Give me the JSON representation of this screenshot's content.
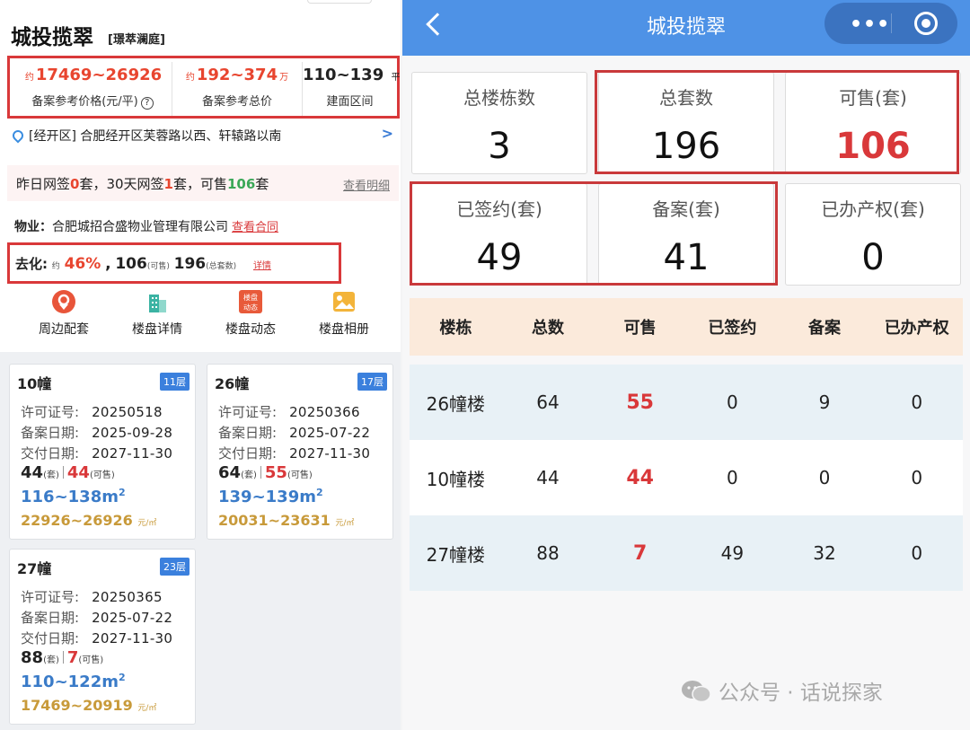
{
  "left": {
    "title": "城投揽翠",
    "alias": "[璟萃澜庭]",
    "price": {
      "unit_price_prefix": "约",
      "unit_price": "17469~26926",
      "unit_price_label": "备案参考价格(元/平)",
      "total_prefix": "约",
      "total_price": "192~374",
      "total_unit": "万",
      "total_label": "备案参考总价",
      "area": "110~139",
      "area_unit": "平",
      "area_label": "建面区间"
    },
    "address": "[经开区] 合肥经开区芙蓉路以西、轩辕路以南",
    "sign": {
      "t1": "昨日网签",
      "v1": "0",
      "t2": "套，30天网签",
      "v2": "1",
      "t3": "套，可售",
      "v3": "106",
      "t4": "套",
      "detail": "查看明细"
    },
    "property": {
      "label": "物业：",
      "company": "合肥城招合盛物业管理有限公司",
      "contract": "查看合同"
    },
    "destock": {
      "label": "去化:",
      "approx": "约",
      "rate": "46%",
      "sep": ",",
      "available": "106",
      "available_tag": "(可售)",
      "total": "196",
      "total_tag": "(总套数)",
      "link": "详情"
    },
    "nav": [
      {
        "label": "周边配套"
      },
      {
        "label": "楼盘详情"
      },
      {
        "label": "楼盘动态",
        "icon_text1": "楼盘",
        "icon_text2": "动态"
      },
      {
        "label": "楼盘相册"
      }
    ],
    "cards": [
      {
        "name": "10幢",
        "floors": "11层",
        "permit_k": "许可证号:",
        "permit": "20250518",
        "record_k": "备案日期:",
        "record": "2025-09-28",
        "deliver_k": "交付日期:",
        "deliver": "2027-11-30",
        "total": "44",
        "total_unit": "(套)",
        "avail": "44",
        "avail_tag": "(可售)",
        "area": "116~138m",
        "area_sup": "2",
        "price": "22926~26926",
        "price_unit": "元/㎡"
      },
      {
        "name": "26幢",
        "floors": "17层",
        "permit_k": "许可证号:",
        "permit": "20250366",
        "record_k": "备案日期:",
        "record": "2025-07-22",
        "deliver_k": "交付日期:",
        "deliver": "2027-11-30",
        "total": "64",
        "total_unit": "(套)",
        "avail": "55",
        "avail_tag": "(可售)",
        "area": "139~139m",
        "area_sup": "2",
        "price": "20031~23631",
        "price_unit": "元/㎡"
      },
      {
        "name": "27幢",
        "floors": "23层",
        "permit_k": "许可证号:",
        "permit": "20250365",
        "record_k": "备案日期:",
        "record": "2025-07-22",
        "deliver_k": "交付日期:",
        "deliver": "2027-11-30",
        "total": "88",
        "total_unit": "(套)",
        "avail": "7",
        "avail_tag": "(可售)",
        "area": "110~122m",
        "area_sup": "2",
        "price": "17469~20919",
        "price_unit": "元/㎡"
      }
    ]
  },
  "right": {
    "title": "城投揽翠",
    "stats": [
      {
        "label": "总楼栋数",
        "value": "3"
      },
      {
        "label": "总套数",
        "value": "196"
      },
      {
        "label": "可售(套)",
        "value": "106"
      },
      {
        "label": "已签约(套)",
        "value": "49"
      },
      {
        "label": "备案(套)",
        "value": "41"
      },
      {
        "label": "已办产权(套)",
        "value": "0"
      }
    ],
    "table": {
      "headers": [
        "楼栋",
        "总数",
        "可售",
        "已签约",
        "备案",
        "已办产权"
      ],
      "rows": [
        [
          "26幢楼",
          "64",
          "55",
          "0",
          "9",
          "0"
        ],
        [
          "10幢楼",
          "44",
          "44",
          "0",
          "0",
          "0"
        ],
        [
          "27幢楼",
          "88",
          "7",
          "49",
          "32",
          "0"
        ]
      ]
    },
    "watermark": "公众号 · 话说探家"
  },
  "colors": {
    "accent_red": "#d9383a",
    "header_blue": "#4e92e6",
    "link_blue": "#3a7bc8",
    "price_gold": "#c89a3a",
    "available_green": "#3aa757"
  }
}
